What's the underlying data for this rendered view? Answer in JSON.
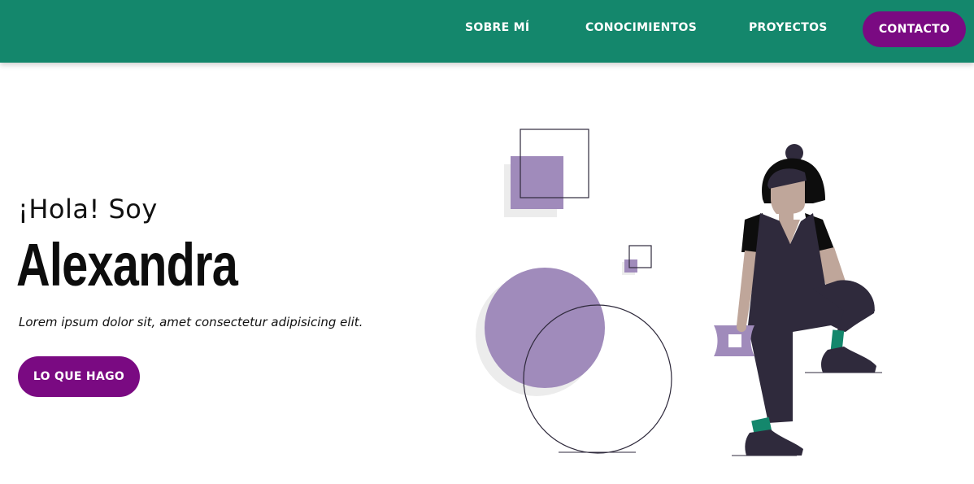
{
  "nav": {
    "items": [
      {
        "label": "SOBRE MÍ"
      },
      {
        "label": "CONOCIMIENTOS"
      },
      {
        "label": "PROYECTOS"
      }
    ],
    "contact_label": "CONTACTO"
  },
  "hero": {
    "greeting": "¡Hola! Soy",
    "name": "Alexandra",
    "tagline": "Lorem ipsum dolor sit, amet consectetur adipisicing elit.",
    "cta_label": "LO QUE HAGO"
  },
  "colors": {
    "navbar": "#14876c",
    "accent": "#7a0a82",
    "illustration_purple": "#a08bbb",
    "illustration_dark": "#2f2a3c",
    "illustration_green": "#14876c"
  }
}
